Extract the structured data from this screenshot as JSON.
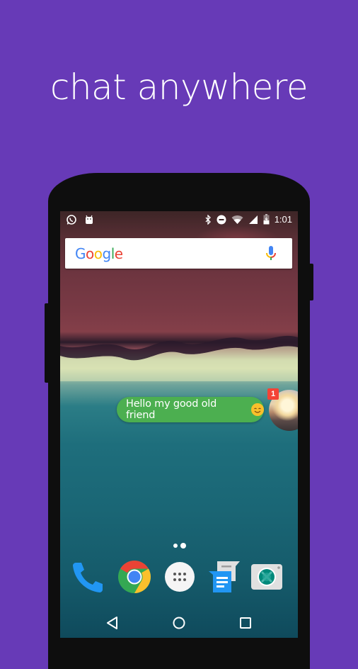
{
  "headline": "chat anywhere",
  "colors": {
    "background": "#673ab7",
    "bubble": "#4caf50",
    "badge": "#f44336",
    "phone_frame": "#0e0e0e"
  },
  "status_bar": {
    "left_icons": [
      "whatsapp-icon",
      "android-robot-icon"
    ],
    "right_icons": [
      "bluetooth-icon",
      "do-not-disturb-icon",
      "wifi-icon",
      "cellular-signal-icon",
      "battery-charging-icon"
    ],
    "time": "1:01"
  },
  "search_widget": {
    "logo": "Google",
    "mic_icon": "microphone-icon"
  },
  "chat_head": {
    "message": "Hello my good old friend",
    "emoji": "smiling-face-emoji",
    "unread_count": "1"
  },
  "page_indicator": {
    "pages": 2,
    "current": 2
  },
  "dock": {
    "apps": [
      "Phone",
      "Chrome",
      "App drawer",
      "Messages",
      "Camera"
    ]
  },
  "navigation": [
    "Back",
    "Home",
    "Recents"
  ]
}
